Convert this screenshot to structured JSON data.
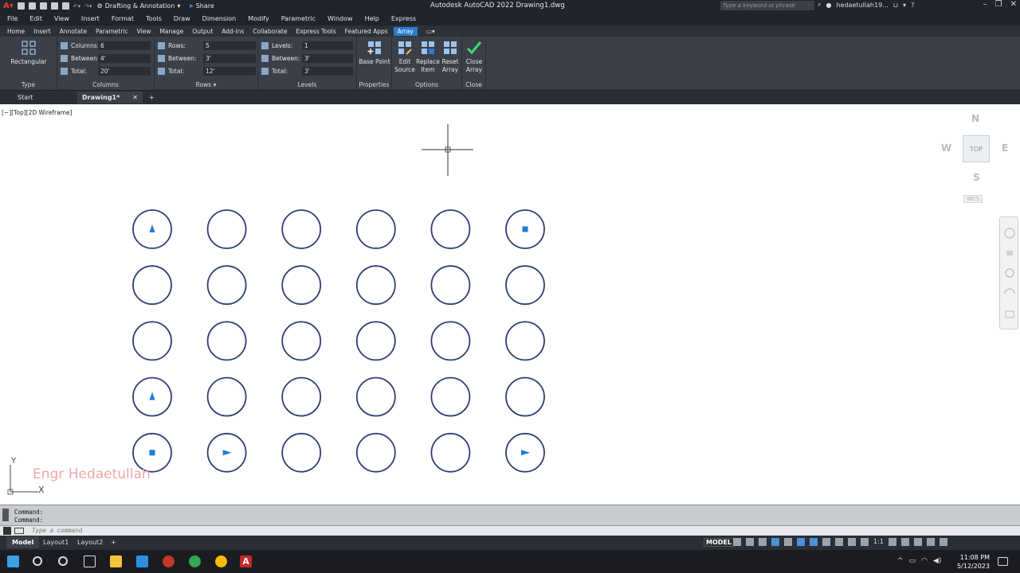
{
  "titlebar": {
    "workspace": "Drafting & Annotation",
    "share": "Share",
    "title": "Autodesk AutoCAD 2022    Drawing1.dwg",
    "search_placeholder": "Type a keyword or phrase",
    "user": "hedaetullah19..."
  },
  "menu": [
    "File",
    "Edit",
    "View",
    "Insert",
    "Format",
    "Tools",
    "Draw",
    "Dimension",
    "Modify",
    "Parametric",
    "Window",
    "Help",
    "Express"
  ],
  "ribbon_tabs": [
    "Home",
    "Insert",
    "Annotate",
    "Parametric",
    "View",
    "Manage",
    "Output",
    "Add-ins",
    "Collaborate",
    "Express Tools",
    "Featured Apps",
    "Array"
  ],
  "ribbon": {
    "type": {
      "button": "Rectangular",
      "label": "Type"
    },
    "columns": {
      "label": "Columns",
      "count_label": "Columns:",
      "count": "6",
      "between_label": "Between:",
      "between": "4'",
      "total_label": "Total:",
      "total": "20'"
    },
    "rows": {
      "label": "Rows",
      "count_label": "Rows:",
      "count": "5",
      "between_label": "Between:",
      "between": "3'",
      "total_label": "Total:",
      "total": "12'"
    },
    "levels": {
      "label": "Levels",
      "count_label": "Levels:",
      "count": "1",
      "between_label": "Between:",
      "between": "3'",
      "total_label": "Total:",
      "total": "3'"
    },
    "properties": {
      "label": "Properties",
      "base_point": "Base Point"
    },
    "options": {
      "label": "Options",
      "edit_source": "Edit Source",
      "replace_item": "Replace Item",
      "reset_array": "Reset Array"
    },
    "close": {
      "label": "Close",
      "close_array": "Close Array"
    }
  },
  "doc_tabs": {
    "start": "Start",
    "active": "Drawing1*",
    "close": "✕",
    "add": "+"
  },
  "viewport_label": "[−][Top][2D Wireframe]",
  "viewcube": {
    "n": "N",
    "s": "S",
    "e": "E",
    "w": "W",
    "top": "TOP",
    "wcs": "WCS"
  },
  "watermark": "Engr Hedaetullah",
  "ucs": {
    "x": "X",
    "y": "Y"
  },
  "drawing": {
    "rows": 5,
    "cols": 6,
    "markers": [
      {
        "row": 0,
        "col": 0,
        "shape": "triangle-up"
      },
      {
        "row": 0,
        "col": 5,
        "shape": "square"
      },
      {
        "row": 3,
        "col": 0,
        "shape": "triangle-up"
      },
      {
        "row": 4,
        "col": 0,
        "shape": "square"
      },
      {
        "row": 4,
        "col": 1,
        "shape": "triangle-right"
      },
      {
        "row": 4,
        "col": 5,
        "shape": "triangle-right"
      }
    ],
    "circle_color": "#2e3f73",
    "marker_color": "#1f7ad6"
  },
  "command": {
    "history": [
      "Command:",
      "Command:"
    ],
    "placeholder": "Type a command"
  },
  "layout_tabs": [
    "Model",
    "Layout1",
    "Layout2"
  ],
  "status": {
    "model": "MODEL",
    "scale": "1:1"
  },
  "clock": {
    "time": "11:08 PM",
    "date": "5/12/2023"
  }
}
